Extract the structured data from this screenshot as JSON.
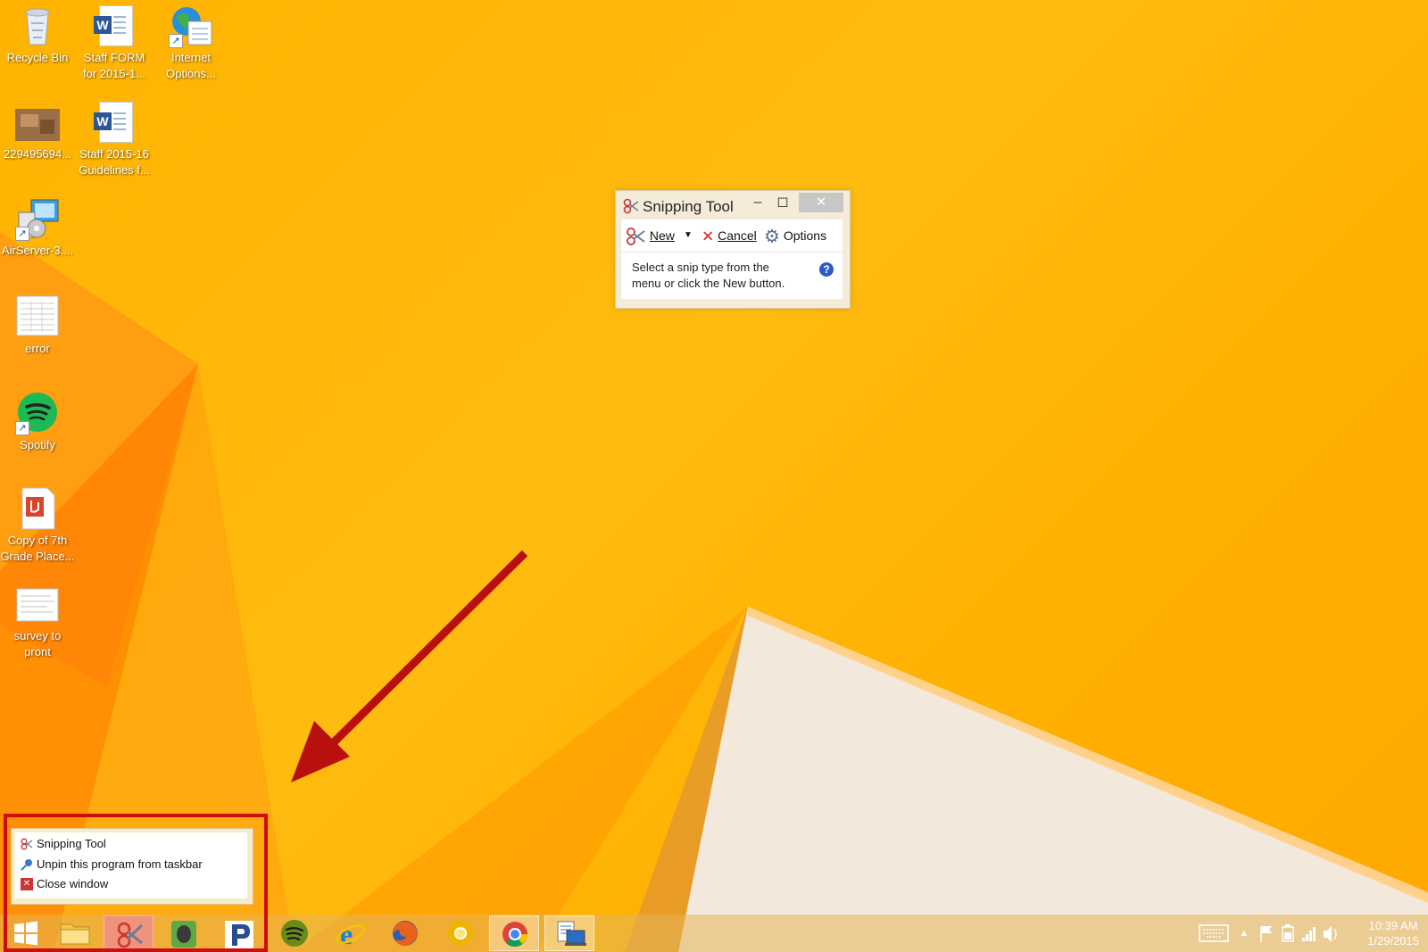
{
  "desktop": {
    "icons": [
      {
        "label_1": "Recycle Bin",
        "label_2": ""
      },
      {
        "label_1": "Staff FORM",
        "label_2": "for 2015-1..."
      },
      {
        "label_1": "Internet",
        "label_2": "Options..."
      },
      {
        "label_1": "229495694...",
        "label_2": ""
      },
      {
        "label_1": "Staff 2015-16",
        "label_2": "Guidelines f..."
      },
      {
        "label_1": "AirServer-3....",
        "label_2": ""
      },
      {
        "label_1": "error",
        "label_2": ""
      },
      {
        "label_1": "Spotify",
        "label_2": ""
      },
      {
        "label_1": "Copy of 7th",
        "label_2": "Grade Place..."
      },
      {
        "label_1": "survey to",
        "label_2": "pront"
      }
    ]
  },
  "snipping_tool": {
    "title": "Snipping Tool",
    "toolbar": {
      "new_label": "New",
      "cancel_label": "Cancel",
      "options_label": "Options"
    },
    "message_line1": "Select a snip type from the",
    "message_line2": "menu or click the New button.",
    "help_glyph": "?"
  },
  "jump_list": {
    "items": [
      {
        "label": "Snipping Tool",
        "icon": "scissors-icon"
      },
      {
        "label": "Unpin this program from taskbar",
        "icon": "unpin-icon"
      },
      {
        "label": "Close window",
        "icon": "close-icon"
      }
    ]
  },
  "taskbar": {
    "apps": [
      "start",
      "file-explorer",
      "snipping-tool",
      "evernote",
      "pandora",
      "spotify",
      "internet-explorer",
      "firefox",
      "chrome-canary",
      "chrome",
      "remote-desktop"
    ],
    "clock_time": "10:39 AM",
    "clock_date": "1/29/2015"
  },
  "colors": {
    "accent": "#cc0d0d",
    "wallpaper": "#ffb300",
    "arrow": "#b80f0f"
  }
}
